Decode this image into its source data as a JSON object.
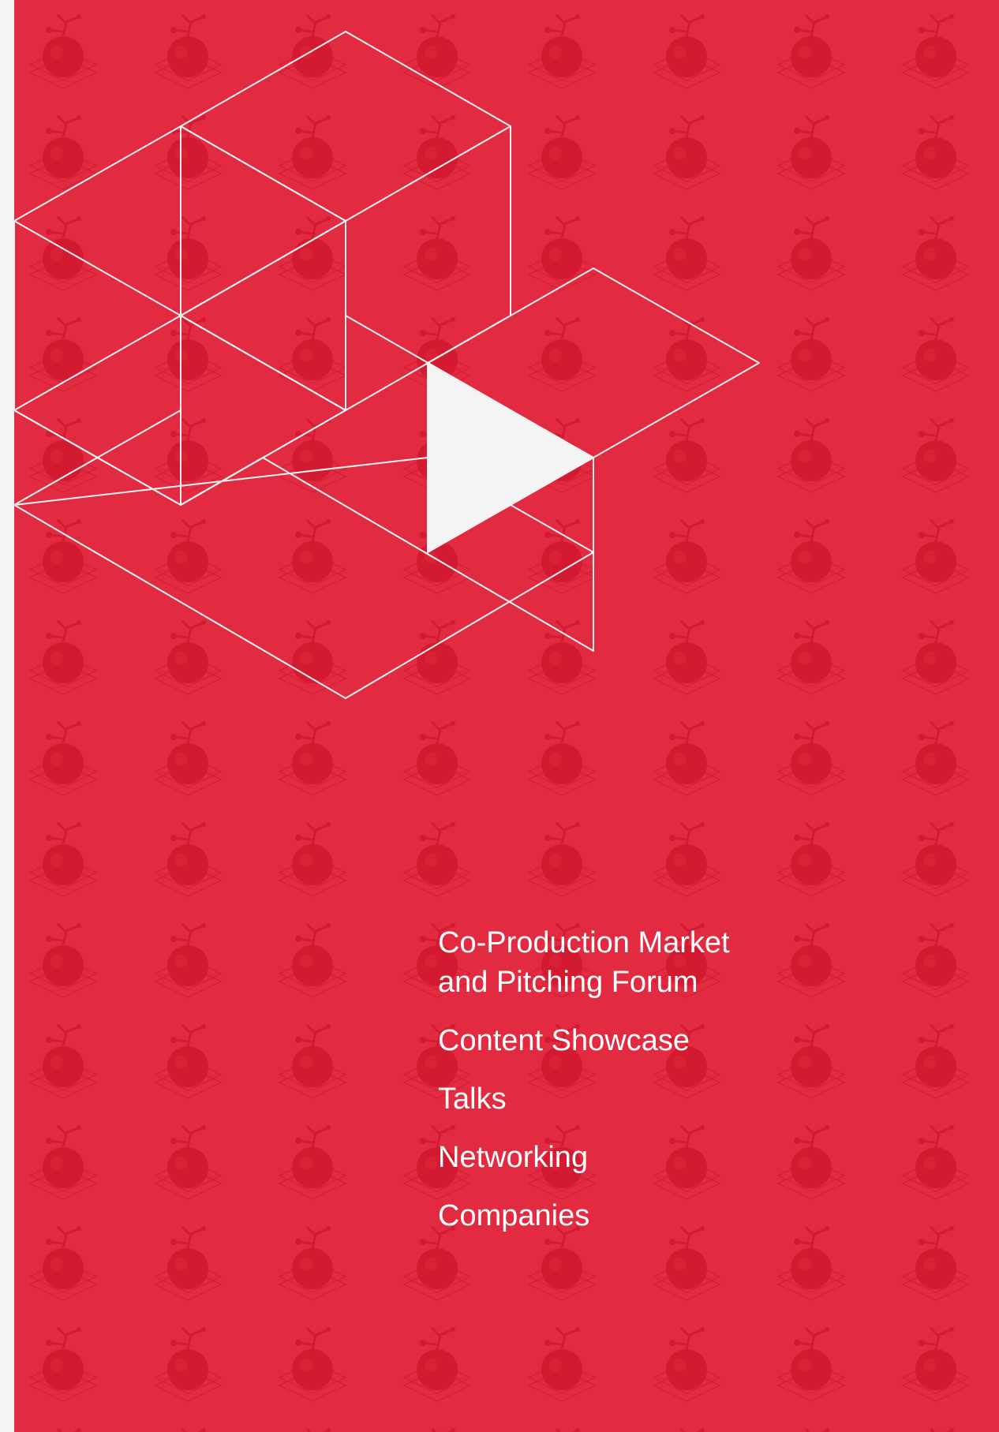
{
  "theme": {
    "panel_color": "#e22a41",
    "pattern_color": "#d31a30",
    "line_color": "#f2f2f2",
    "play_color": "#f4f4f4",
    "text_color": "#ffffff"
  },
  "background": {
    "pattern_icon": "apple-on-stand-icon"
  },
  "hero": {
    "icon": "play-icon",
    "graphic": "isometric-cubes-outline"
  },
  "menu": {
    "items": [
      {
        "label": "Co-Production Market\nand Pitching Forum"
      },
      {
        "label": "Content Showcase"
      },
      {
        "label": "Talks"
      },
      {
        "label": "Networking"
      },
      {
        "label": "Companies"
      }
    ]
  }
}
